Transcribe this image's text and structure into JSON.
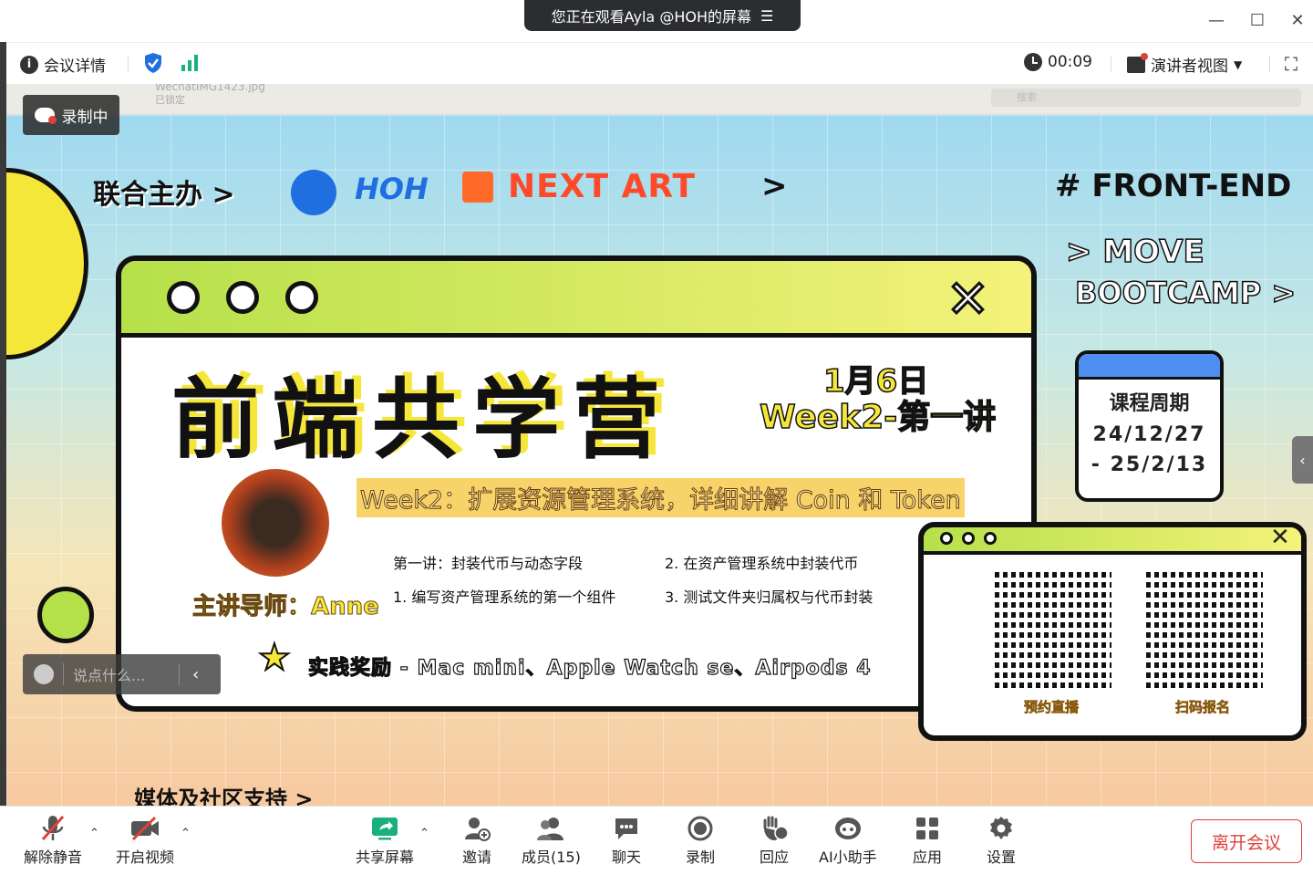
{
  "share_banner": {
    "text": "您正在观看Ayla @HOH的屏幕"
  },
  "info_bar": {
    "meeting_details": "会议详情",
    "timer": "00:09",
    "speaker_view": "演讲者视图"
  },
  "shared_window": {
    "file_name": "WechatIMG1423.jpg",
    "locked": "已锁定",
    "search_placeholder": "搜索"
  },
  "recording_badge": "录制中",
  "chat_input_placeholder": "说点什么...",
  "poster": {
    "co_host_label": "联合主办 >",
    "hoh": "HOH",
    "next_art": "NEXT ART",
    "front_end": "# FRONT-END",
    "move": "> MOVE",
    "bootcamp": "BOOTCAMP >",
    "title": "前端共学营",
    "date": "1月6日",
    "week_lecture": "Week2-第一讲",
    "subtitle": "Week2：扩展资源管理系统，详细讲解 Coin 和 Token",
    "mentor": "主讲导师：Anne",
    "items": [
      "第一讲：封装代币与动态字段",
      "2. 在资产管理系统中封装代币",
      "1. 编写资产管理系统的第一个组件",
      "3. 测试文件夹归属权与代币封装"
    ],
    "reward": "实践奖励 - Mac mini、Apple Watch se、Airpods 4",
    "cycle_title": "课程周期",
    "cycle_start": "24/12/27",
    "cycle_end": "- 25/2/13",
    "qr1_label": "预约直播",
    "qr2_label": "扫码报名",
    "media": "媒体及社区支持 >"
  },
  "toolbar": {
    "unmute": "解除静音",
    "start_video": "开启视频",
    "share_screen": "共享屏幕",
    "invite": "邀请",
    "members": "成员(15)",
    "chat": "聊天",
    "record": "录制",
    "reactions": "回应",
    "ai_assistant": "AI小助手",
    "apps": "应用",
    "settings": "设置",
    "leave": "离开会议"
  },
  "colors": {
    "accent_blue": "#1f6fe0",
    "leave_red": "#e0403a",
    "share_green": "#19b07c"
  }
}
